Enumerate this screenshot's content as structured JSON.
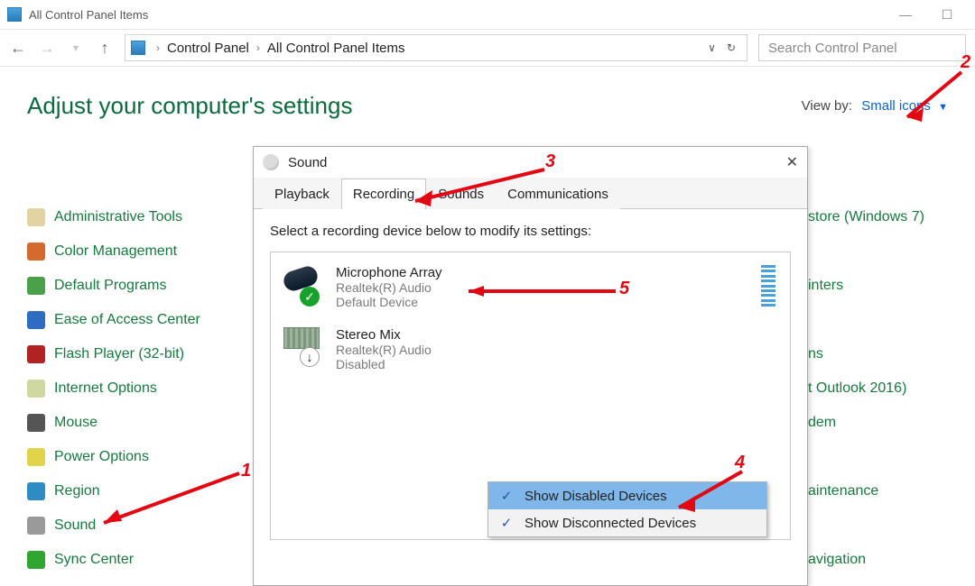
{
  "titlebar": {
    "title": "All Control Panel Items"
  },
  "address": {
    "crumbs": [
      "Control Panel",
      "All Control Panel Items"
    ]
  },
  "search": {
    "placeholder": "Search Control Panel"
  },
  "heading": "Adjust your computer's settings",
  "viewby": {
    "label": "View by:",
    "value": "Small icons"
  },
  "cp_items_left": [
    "Administrative Tools",
    "Color Management",
    "Default Programs",
    "Ease of Access Center",
    "Flash Player (32-bit)",
    "Internet Options",
    "Mouse",
    "Power Options",
    "Region",
    "Sound",
    "Sync Center"
  ],
  "cp_items_right": [
    "store (Windows 7)",
    "inters",
    "ns",
    "t Outlook 2016)",
    "dem",
    "aintenance",
    "avigation"
  ],
  "cp_items_right_offsets": [
    0,
    2,
    4,
    5,
    6,
    8,
    10
  ],
  "sound_dialog": {
    "title": "Sound",
    "tabs": [
      "Playback",
      "Recording",
      "Sounds",
      "Communications"
    ],
    "active_tab": 1,
    "hint": "Select a recording device below to modify its settings:",
    "devices": [
      {
        "name": "Microphone Array",
        "driver": "Realtek(R) Audio",
        "status": "Default Device",
        "default": true
      },
      {
        "name": "Stereo Mix",
        "driver": "Realtek(R) Audio",
        "status": "Disabled",
        "default": false
      }
    ],
    "context_menu": [
      {
        "label": "Show Disabled Devices",
        "checked": true,
        "selected": true
      },
      {
        "label": "Show Disconnected Devices",
        "checked": true,
        "selected": false
      }
    ]
  },
  "annotations": [
    "1",
    "2",
    "3",
    "4",
    "5"
  ]
}
